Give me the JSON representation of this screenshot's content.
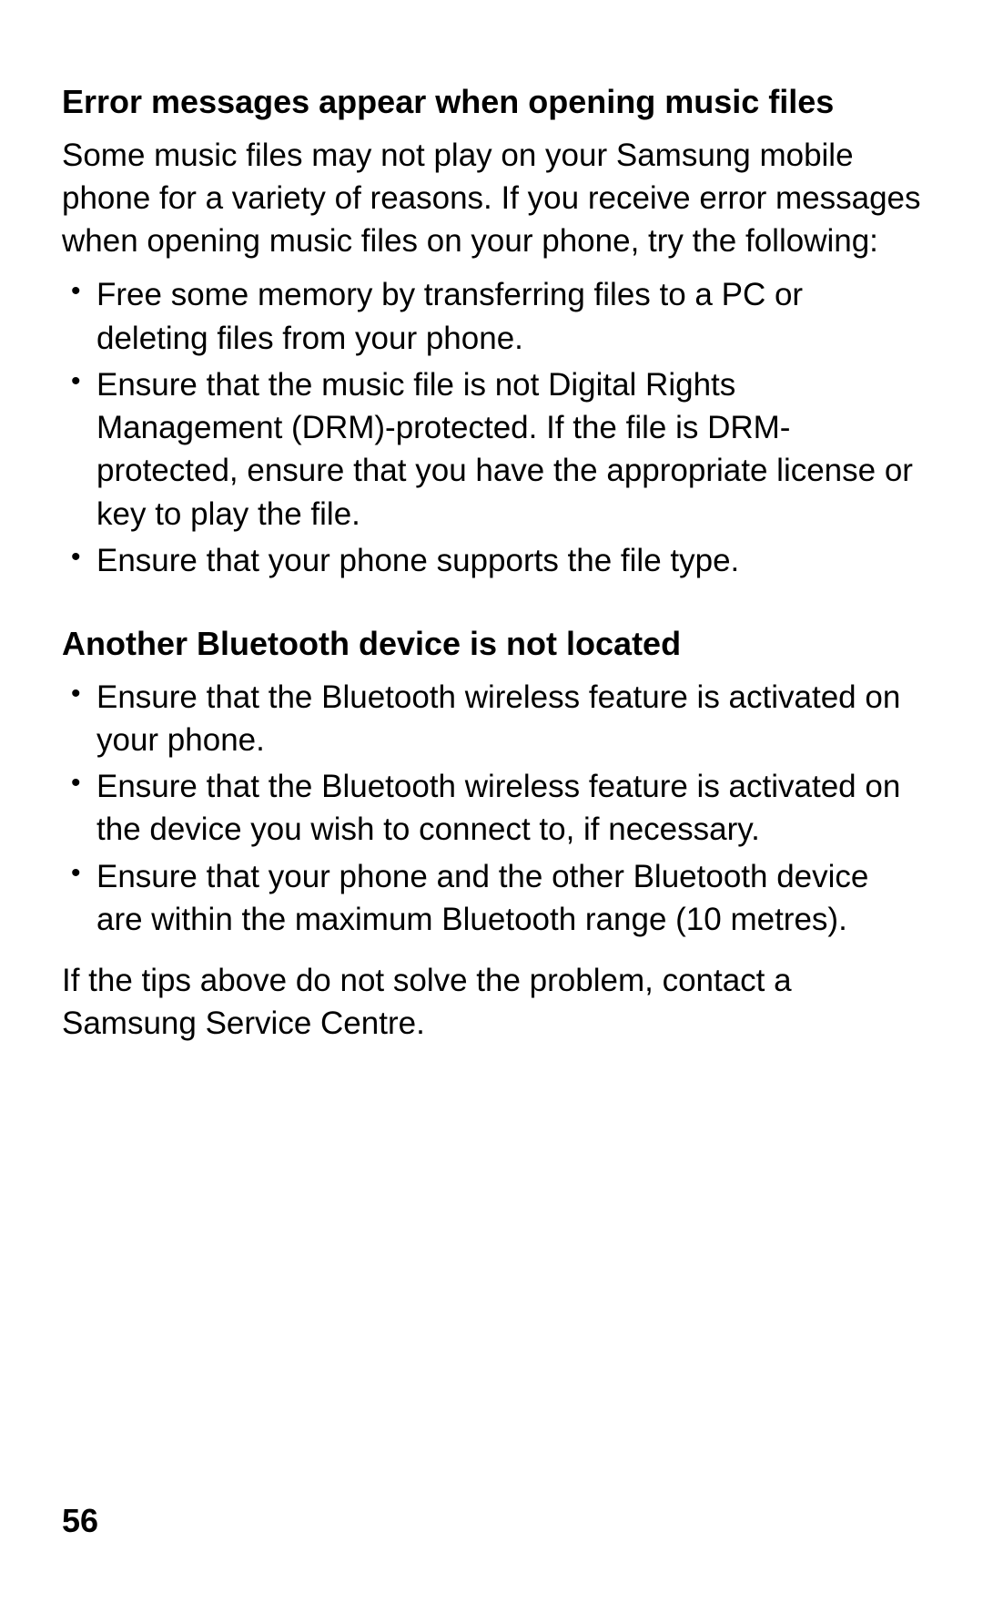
{
  "section1": {
    "heading": "Error messages appear when opening music files",
    "intro": "Some music files may not play on your Samsung mobile phone for a variety of reasons. If you receive error messages when opening music files on your phone, try the following:",
    "bullets": [
      "Free some memory by transferring files to a PC or deleting files from your phone.",
      "Ensure that the music file is not Digital Rights Management (DRM)-protected. If the file is DRM-protected, ensure that you have the appropriate license or key to play the file.",
      "Ensure that your phone supports the file type."
    ]
  },
  "section2": {
    "heading": "Another Bluetooth device is not located",
    "bullets": [
      "Ensure that the Bluetooth wireless feature is activated on your phone.",
      "Ensure that the Bluetooth wireless feature is activated on the device you wish to connect to, if necessary.",
      "Ensure that your phone and the other Bluetooth device are within the maximum Bluetooth range (10 metres)."
    ],
    "closing": "If the tips above do not solve the problem, contact a Samsung Service Centre."
  },
  "page_number": "56"
}
